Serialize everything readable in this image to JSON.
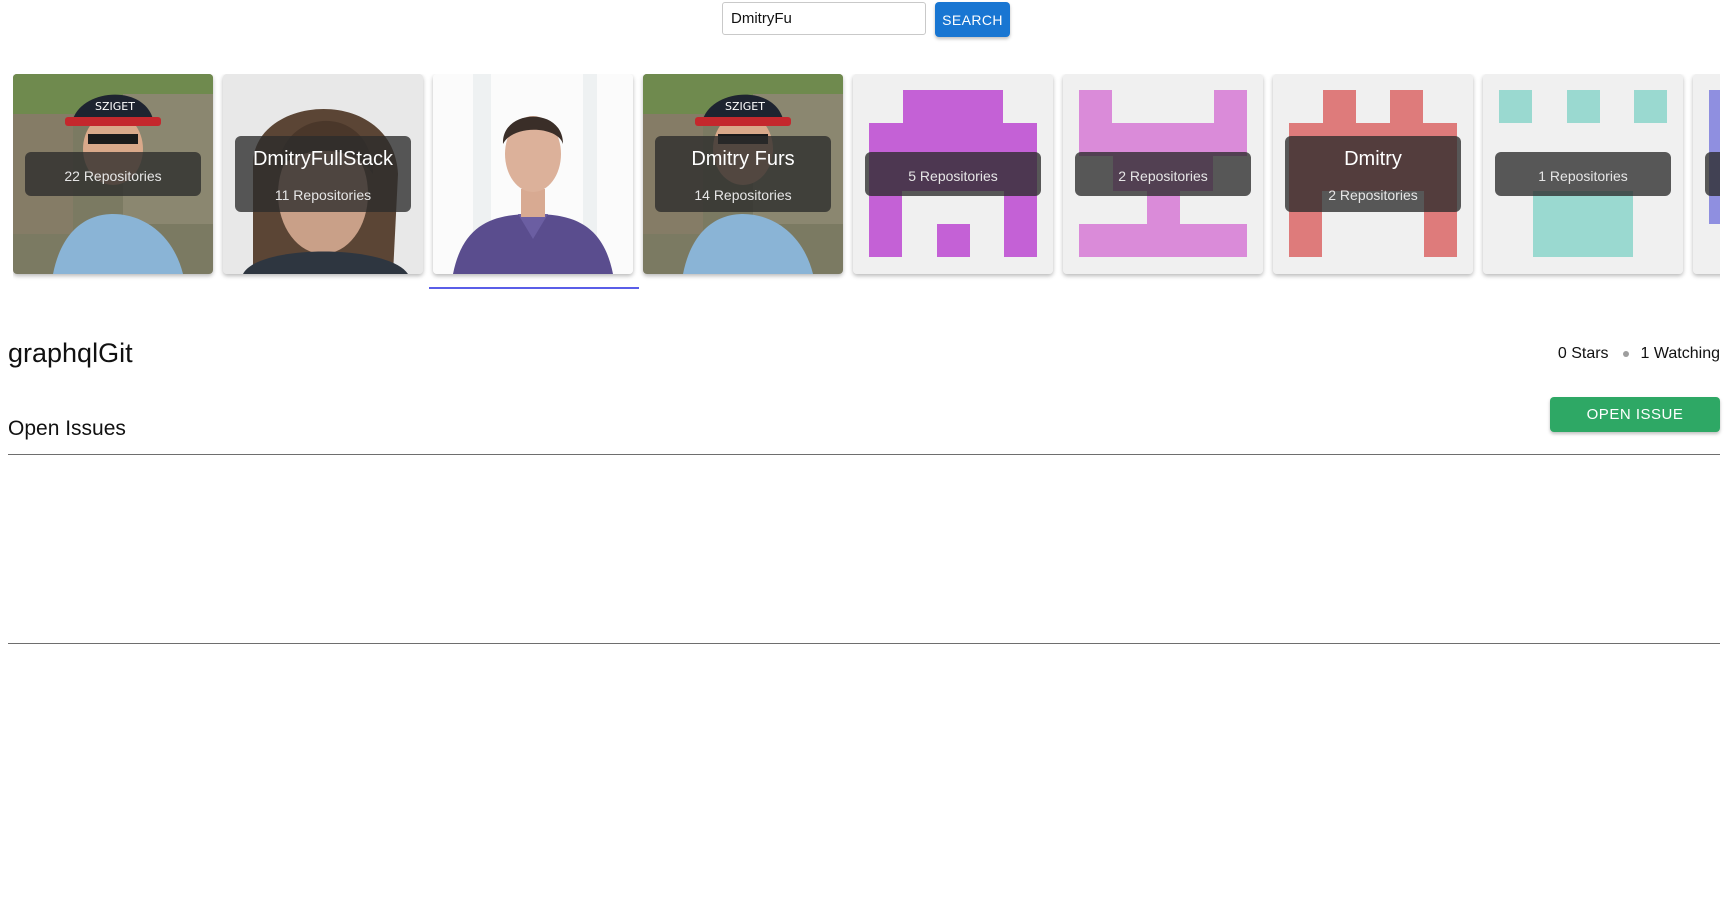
{
  "search": {
    "value": "DmitryFu",
    "button_label": "SEARCH"
  },
  "users": [
    {
      "name": "",
      "repos": "22 Repositories",
      "avatar": "photo-cap-sunglasses"
    },
    {
      "name": "DmitryFullStack",
      "repos": "11 Repositories",
      "avatar": "photo-long-hair"
    },
    {
      "name": "",
      "repos": "",
      "avatar": "photo-portrait-shirt",
      "selected": true
    },
    {
      "name": "Dmitry Furs",
      "repos": "14 Repositories",
      "avatar": "photo-cap-sunglasses"
    },
    {
      "name": "",
      "repos": "5 Repositories",
      "avatar": "identicon-purple",
      "color": "#c461d6"
    },
    {
      "name": "",
      "repos": "2 Repositories",
      "avatar": "identicon-pink",
      "color": "#da8bd9"
    },
    {
      "name": "Dmitry",
      "repos": "2 Repositories",
      "avatar": "identicon-red",
      "color": "#de7b7b"
    },
    {
      "name": "",
      "repos": "1 Repositories",
      "avatar": "identicon-teal",
      "color": "#9ad9d0"
    },
    {
      "name": "",
      "repos": "",
      "avatar": "identicon-blue",
      "color": "#8f8fe0"
    }
  ],
  "repo": {
    "title": "graphqlGit",
    "stars": "0 Stars",
    "watching": "1 Watching"
  },
  "issues": {
    "title": "Open Issues",
    "open_button_label": "OPEN ISSUE"
  },
  "colors": {
    "search_button": "#1976d2",
    "open_issue_button": "#2ea865",
    "selected_indicator": "#5a5ee8"
  }
}
